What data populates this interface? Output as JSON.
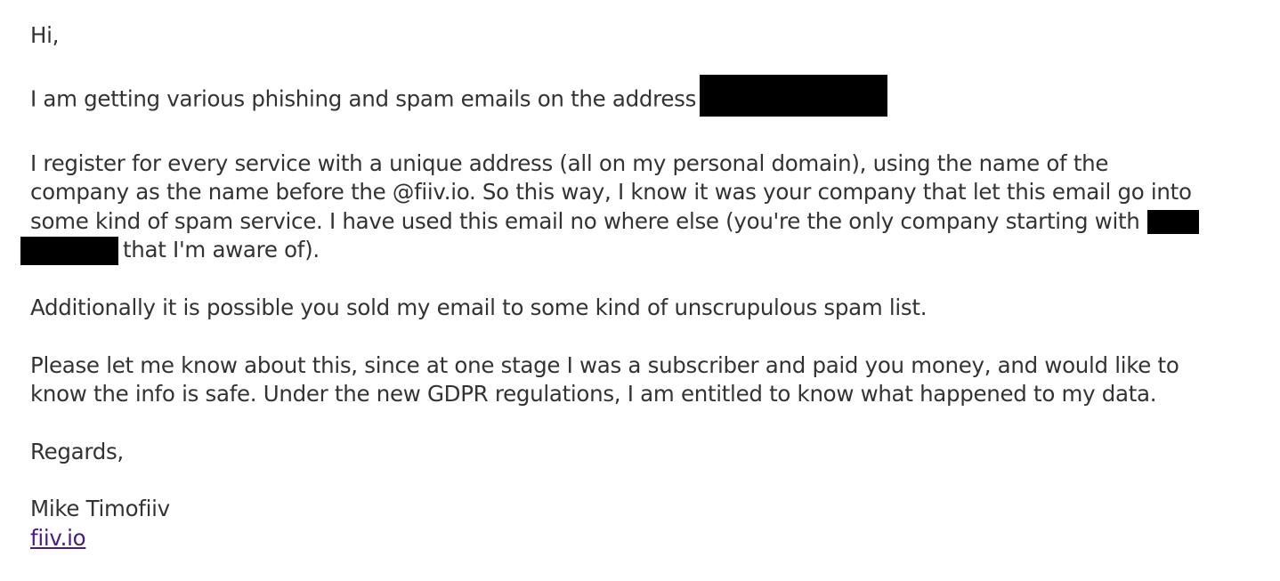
{
  "email": {
    "greeting": "Hi,",
    "p1_text": "I am getting various phishing and spam emails on the address",
    "p2_line1": "I register for every service with a unique address (all on my personal domain), using the name of the",
    "p2_line2": "company as the name before the @fiiv.io. So this way, I know it was your company that let this email go into",
    "p2_line3": "some kind of spam service. I have used this email no where else (you're the only company starting with",
    "p2_line4": "that I'm aware of).",
    "p3_text": "Additionally it is possible you sold my email to some kind of unscrupulous spam list.",
    "p4_line1": "Please let me know about this, since at one stage I was a subscriber and paid you money, and would like to",
    "p4_line2": "know the info is safe. Under the new GDPR regulations, I am entitled to know what happened to my data.",
    "closing": "Regards,",
    "signature_name": "Mike Timofiiv",
    "signature_link": "fiiv.io"
  },
  "colors": {
    "text": "#333333",
    "link": "#4a1a8c",
    "redaction": "#000000",
    "background": "#ffffff"
  }
}
